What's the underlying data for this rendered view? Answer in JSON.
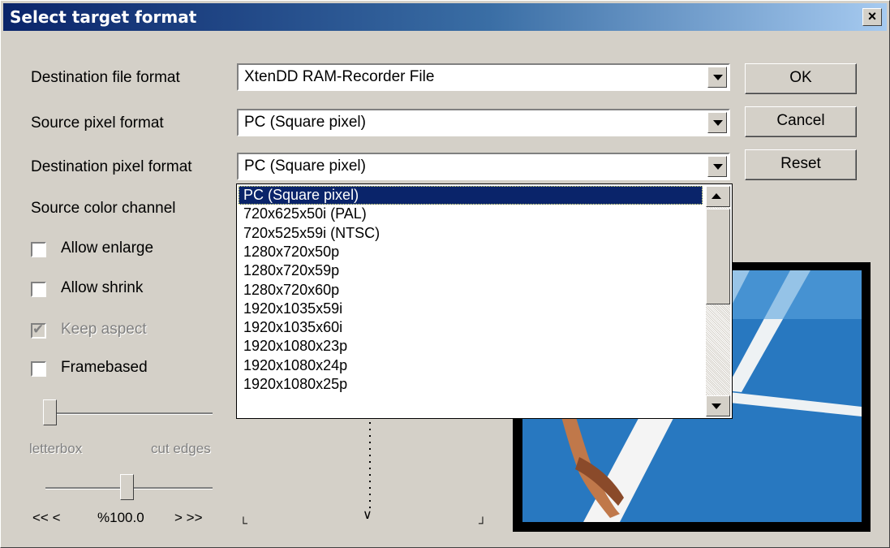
{
  "window": {
    "title": "Select target format",
    "close_label": "×"
  },
  "labels": {
    "destination_file_format": "Destination file format",
    "source_pixel_format": "Source pixel format",
    "destination_pixel_format": "Destination pixel format",
    "source_color_channel": "Source color channel"
  },
  "combos": {
    "destination_file_format": "XtenDD RAM-Recorder File",
    "source_pixel_format": "PC (Square pixel)",
    "destination_pixel_format": "PC (Square pixel)"
  },
  "buttons": {
    "ok": "OK",
    "cancel": "Cancel",
    "reset": "Reset"
  },
  "checkboxes": [
    {
      "label": "Allow enlarge",
      "checked": false,
      "enabled": true
    },
    {
      "label": "Allow shrink",
      "checked": false,
      "enabled": true
    },
    {
      "label": "Keep aspect",
      "checked": true,
      "enabled": false
    },
    {
      "label": "Framebased",
      "checked": false,
      "enabled": true
    }
  ],
  "slider1": {
    "left_label": "letterbox",
    "right_label": "cut edges",
    "value": 0
  },
  "slider2": {
    "left_label": "<< <",
    "value_label": "%100.0",
    "right_label": "> >>",
    "value": 0.5
  },
  "dropdown": {
    "selected_index": 0,
    "options": [
      "PC (Square pixel)",
      "720x625x50i (PAL)",
      "720x525x59i (NTSC)",
      "1280x720x50p",
      "1280x720x59p",
      "1280x720x60p",
      "1920x1035x59i",
      "1920x1035x60i",
      "1920x1080x23p",
      "1920x1080x24p",
      "1920x1080x25p"
    ]
  },
  "preview": {
    "accent": "#2a7fc6"
  }
}
